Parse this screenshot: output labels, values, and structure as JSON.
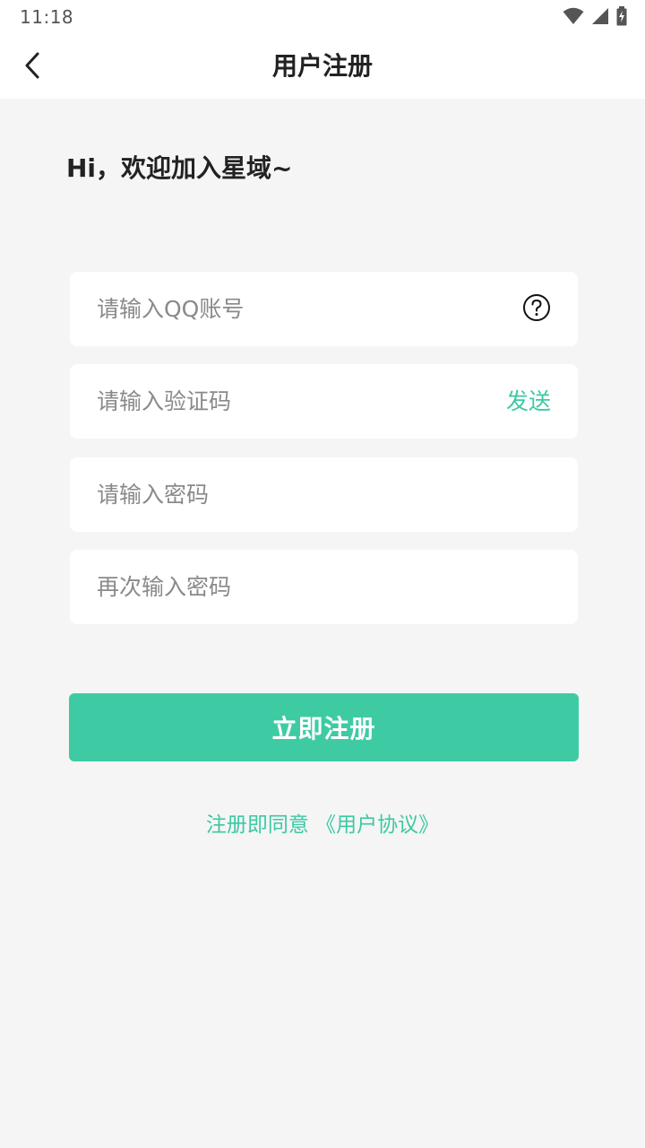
{
  "status_bar": {
    "time": "11:18",
    "icons": [
      "wifi-icon",
      "signal-icon",
      "battery-charging-icon"
    ]
  },
  "nav": {
    "back_icon": "chevron-left-icon",
    "title": "用户注册"
  },
  "welcome_text": "Hi，欢迎加入星域~",
  "form": {
    "qq_placeholder": "请输入QQ账号",
    "help_icon": "question-circle-icon",
    "code_placeholder": "请输入验证码",
    "send_label": "发送",
    "password_placeholder": "请输入密码",
    "password_confirm_placeholder": "再次输入密码"
  },
  "submit_label": "立即注册",
  "agreement": {
    "prefix": "注册即同意 ",
    "link": "《用户协议》"
  },
  "colors": {
    "accent": "#3ecba4",
    "page_background": "#f5f5f5"
  }
}
